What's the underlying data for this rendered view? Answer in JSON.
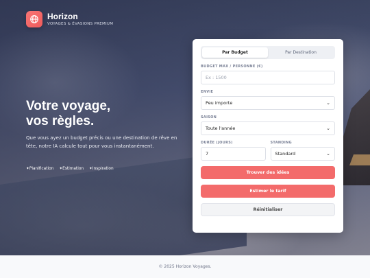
{
  "brand": {
    "name": "Horizon",
    "tagline": "VOYAGES & ÉVASIONS PREMIUM",
    "logo_icon": "globe-icon"
  },
  "hero": {
    "headline_line1": "Votre voyage,",
    "headline_line2": "vos règles.",
    "subtitle": "Que vous ayez un budget précis ou une destination de rêve en tête, notre IA calcule tout pour vous instantanément.",
    "features": [
      "Planification",
      "Estimation",
      "Inspiration"
    ]
  },
  "form": {
    "tabs": [
      {
        "label": "Par Budget",
        "active": true
      },
      {
        "label": "Par Destination",
        "active": false
      }
    ],
    "budget": {
      "label": "BUDGET MAX / PERSONNE (€)",
      "placeholder": "Ex : 1500"
    },
    "envie": {
      "label": "ENVIE",
      "value": "Peu importe"
    },
    "saison": {
      "label": "SAISON",
      "value": "Toute l'année"
    },
    "duree": {
      "label": "DURÉE (JOURS)",
      "value": "7"
    },
    "standing": {
      "label": "STANDING",
      "value": "Standard"
    },
    "buttons": {
      "find": "Trouver des idées",
      "estimate": "Estimer le tarif",
      "reset": "Réinitialiser"
    }
  },
  "footer": {
    "text": "© 2025 Horizon Voyages."
  },
  "colors": {
    "accent": "#f36b6b",
    "card": "#ffffff"
  }
}
